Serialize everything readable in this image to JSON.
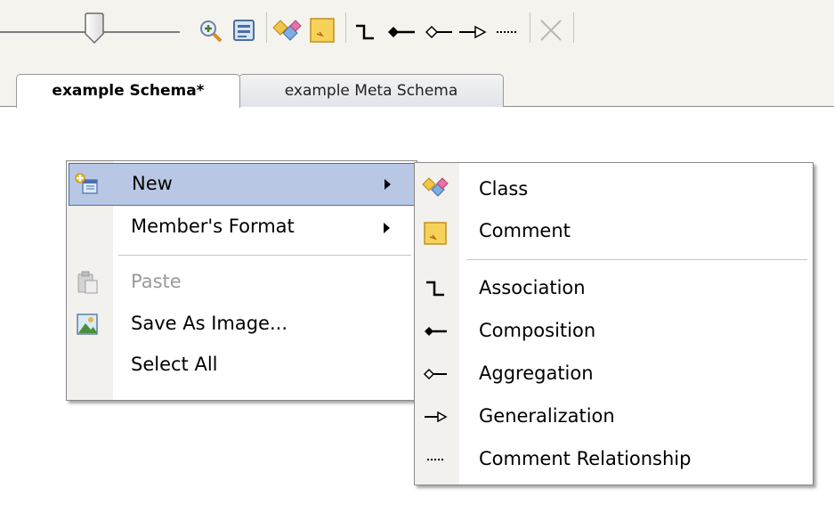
{
  "toolbar": {
    "icons": [
      "zoom-slider",
      "zoom-in-icon",
      "layout-icon",
      "class-icon",
      "comment-icon",
      "association-icon",
      "composition-icon",
      "aggregation-icon",
      "generalization-icon",
      "comment-relationship-icon",
      "delete-icon"
    ]
  },
  "tabs": [
    {
      "label": "example Schema*",
      "active": true
    },
    {
      "label": "example Meta Schema",
      "active": false
    }
  ],
  "context_menu": {
    "items": [
      {
        "label": "New",
        "icon": "new-icon",
        "submenu": true,
        "highlighted": true
      },
      {
        "label": "Member's Format",
        "submenu": true
      },
      {
        "label": "Paste",
        "icon": "paste-icon",
        "disabled": true
      },
      {
        "label": "Save As Image...",
        "icon": "image-icon"
      },
      {
        "label": "Select All"
      }
    ]
  },
  "submenu": {
    "items": [
      {
        "label": "Class",
        "icon": "class-icon"
      },
      {
        "label": "Comment",
        "icon": "comment-icon"
      },
      {
        "label": "Association",
        "icon": "association-icon"
      },
      {
        "label": "Composition",
        "icon": "composition-icon"
      },
      {
        "label": "Aggregation",
        "icon": "aggregation-icon"
      },
      {
        "label": "Generalization",
        "icon": "generalization-icon"
      },
      {
        "label": "Comment Relationship",
        "icon": "comment-relationship-icon"
      }
    ]
  },
  "colors": {
    "highlight": "#b8c7e4",
    "highlight_border": "#4b6ead",
    "disabled_text": "#9a9a9a"
  }
}
